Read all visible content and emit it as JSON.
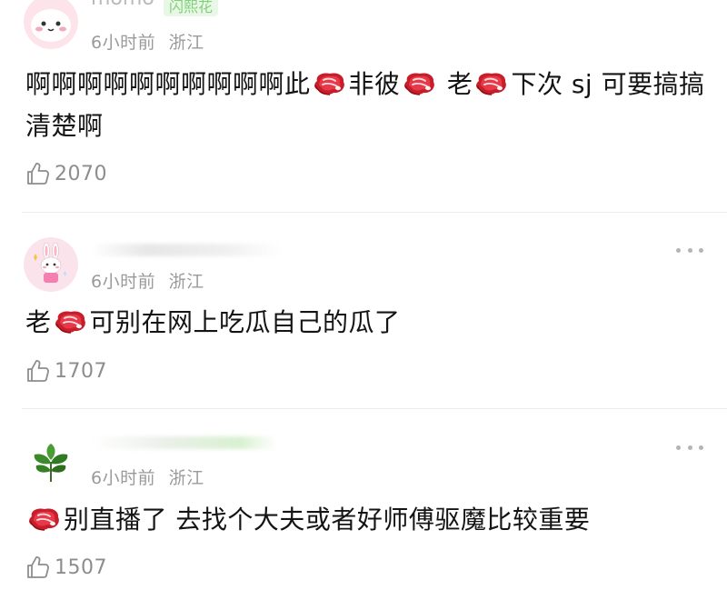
{
  "comments": [
    {
      "username": "momo",
      "badge": "闪熙花",
      "time": "6小时前",
      "location": "浙江",
      "text_parts": [
        "啊啊啊啊啊啊啊啊啊啊此",
        "非彼",
        " 老",
        "下次 sj 可要搞搞清楚啊"
      ],
      "likes": "2070",
      "avatar": "pink-bunny-avatar"
    },
    {
      "time": "6小时前",
      "location": "浙江",
      "text_parts": [
        "老",
        "可别在网上吃瓜自己的瓜了"
      ],
      "likes": "1707",
      "avatar": "white-bunny-avatar"
    },
    {
      "time": "6小时前",
      "location": "浙江",
      "text_parts": [
        "别直播了 去找个大夫或者好师傅驱魔比较重要"
      ],
      "likes": "1507",
      "avatar": "green-leaves-avatar"
    }
  ],
  "icons": {
    "emoji": "steak-emoji-icon",
    "like": "thumbs-up-icon",
    "more": "more-dots-icon"
  },
  "colors": {
    "meta_text": "#9a9a9a",
    "like_count": "#8d8d8d",
    "badge_text": "#7fd07a",
    "divider": "#ececec"
  }
}
